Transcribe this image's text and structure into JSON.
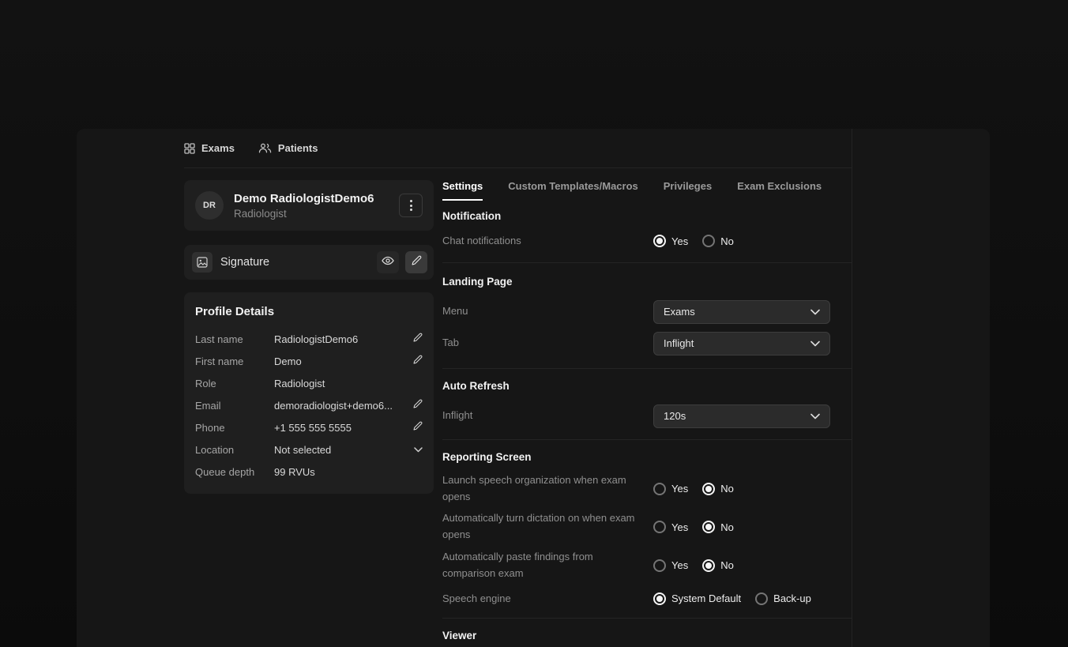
{
  "nav": {
    "items": [
      {
        "label": "Exams"
      },
      {
        "label": "Patients"
      }
    ]
  },
  "profile_card": {
    "initials": "DR",
    "name": "Demo RadiologistDemo6",
    "role": "Radiologist"
  },
  "signature_card": {
    "label": "Signature"
  },
  "profile_details": {
    "title": "Profile Details",
    "rows": [
      {
        "label": "Last name",
        "value": "RadiologistDemo6"
      },
      {
        "label": "First name",
        "value": "Demo"
      },
      {
        "label": "Role",
        "value": "Radiologist"
      },
      {
        "label": "Email",
        "value": "demoradiologist+demo6..."
      },
      {
        "label": "Phone",
        "value": "+1 555 555 5555"
      },
      {
        "label": "Location",
        "value": "Not selected"
      },
      {
        "label": "Queue depth",
        "value": "99 RVUs"
      }
    ]
  },
  "tabs": [
    {
      "label": "Settings",
      "active": true
    },
    {
      "label": "Custom Templates/Macros",
      "active": false
    },
    {
      "label": "Privileges",
      "active": false
    },
    {
      "label": "Exam Exclusions",
      "active": false
    }
  ],
  "settings": {
    "notification": {
      "title": "Notification",
      "chat": {
        "label": "Chat notifications",
        "options": [
          "Yes",
          "No"
        ],
        "selected": "Yes"
      }
    },
    "landing_page": {
      "title": "Landing Page",
      "menu": {
        "label": "Menu",
        "value": "Exams"
      },
      "tab": {
        "label": "Tab",
        "value": "Inflight"
      }
    },
    "auto_refresh": {
      "title": "Auto Refresh",
      "inflight": {
        "label": "Inflight",
        "value": "120s"
      }
    },
    "reporting": {
      "title": "Reporting Screen",
      "rows": [
        {
          "label": "Launch speech organization when exam opens",
          "options": [
            "Yes",
            "No"
          ],
          "selected": "No"
        },
        {
          "label": "Automatically turn dictation on when exam opens",
          "options": [
            "Yes",
            "No"
          ],
          "selected": "No"
        },
        {
          "label": "Automatically paste findings from comparison exam",
          "options": [
            "Yes",
            "No"
          ],
          "selected": "No"
        },
        {
          "label": "Speech engine",
          "options": [
            "System Default",
            "Back-up"
          ],
          "selected": "System Default"
        }
      ]
    },
    "viewer": {
      "title": "Viewer"
    }
  },
  "colors": {
    "background": "#0d0d0d",
    "panel": "#161616",
    "card": "#1f1f1f",
    "divider": "#242424",
    "text_primary": "#f2f2f2",
    "text_secondary": "#8f8f8f"
  }
}
